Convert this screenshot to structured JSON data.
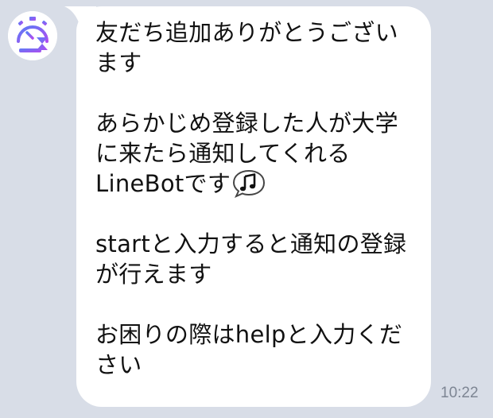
{
  "message": {
    "paragraphs": [
      {
        "lines": [
          "友だち追加ありがとうござい",
          "ます"
        ]
      },
      {
        "lines": [
          "あらかじめ登録した人が大学",
          "に来たら通知してくれる",
          "LineBotです"
        ]
      },
      {
        "lines": [
          "startと入力すると通知の登録",
          "が行えます"
        ]
      },
      {
        "lines": [
          "お困りの際はhelpと入力くだ",
          "さい"
        ]
      }
    ],
    "emoji": "music-note-speech-bubble-icon",
    "timestamp": "10:22"
  },
  "colors": {
    "chat_background": "#d8dde7",
    "bubble": "#ffffff",
    "text": "#111111",
    "timestamp": "#7d8593",
    "avatar_accent": "#8b5cf6"
  }
}
